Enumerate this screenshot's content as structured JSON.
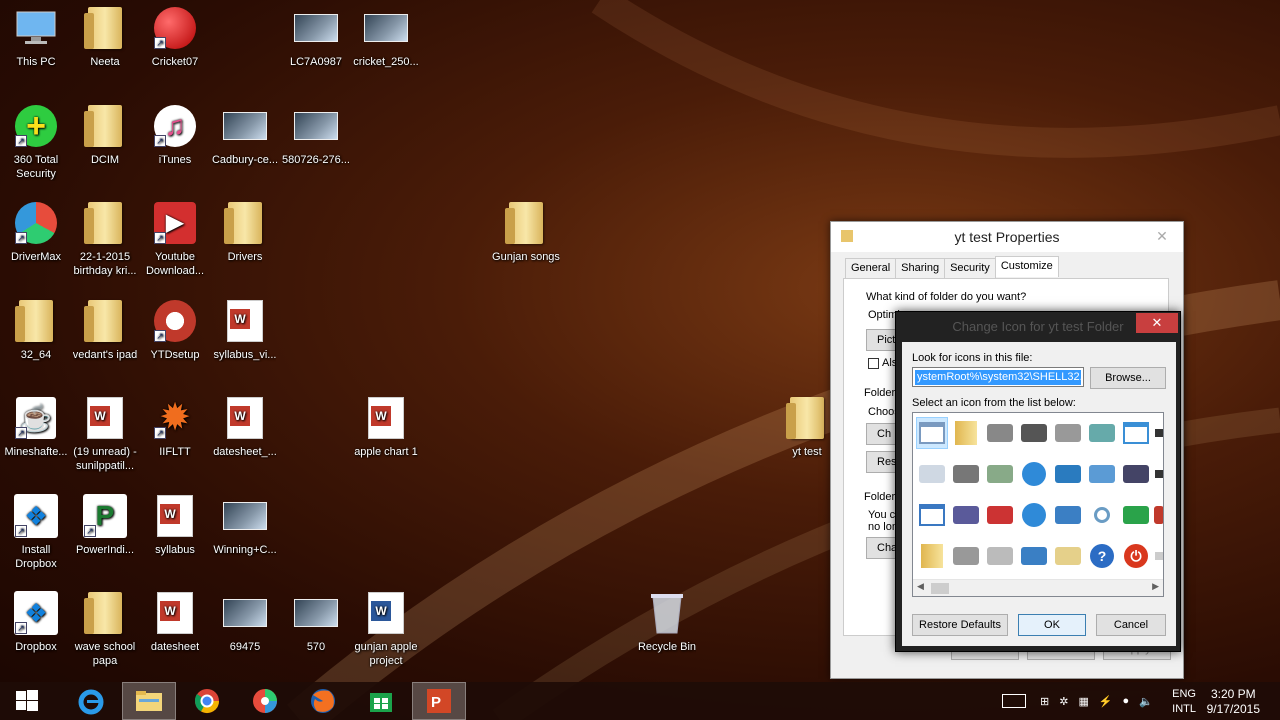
{
  "desktop": {
    "icons": [
      {
        "label": "This PC",
        "icon": "computer-icon"
      },
      {
        "label": "Neeta",
        "icon": "folder-icon"
      },
      {
        "label": "Cricket07",
        "icon": "cricket-ball-icon"
      },
      {
        "label": "LC7A0987",
        "icon": "image-icon"
      },
      {
        "label": "cricket_250...",
        "icon": "image-icon"
      },
      {
        "label": "360 Total Security",
        "icon": "security-plus-icon"
      },
      {
        "label": "DCIM",
        "icon": "folder-icon"
      },
      {
        "label": "iTunes",
        "icon": "music-note-icon"
      },
      {
        "label": "Cadbury-ce...",
        "icon": "image-icon"
      },
      {
        "label": "580726-276...",
        "icon": "image-icon"
      },
      {
        "label": "DriverMax",
        "icon": "drivermax-icon"
      },
      {
        "label": "22-1-2015 birthday kri...",
        "icon": "folder-icon"
      },
      {
        "label": "Youtube Download...",
        "icon": "video-camera-icon"
      },
      {
        "label": "Drivers",
        "icon": "folder-icon"
      },
      {
        "label": "Gunjan songs",
        "icon": "folder-icon"
      },
      {
        "label": "32_64",
        "icon": "folder-icon"
      },
      {
        "label": "vedant's ipad",
        "icon": "folder-icon"
      },
      {
        "label": "YTDsetup",
        "icon": "installer-icon"
      },
      {
        "label": "syllabus_vi...",
        "icon": "wps-document-icon"
      },
      {
        "label": "Mineshafte...",
        "icon": "java-icon"
      },
      {
        "label": "(19 unread) - sunilppatil...",
        "icon": "wps-document-icon"
      },
      {
        "label": "IIFLTT",
        "icon": "mandala-icon"
      },
      {
        "label": "datesheet_...",
        "icon": "wps-document-icon"
      },
      {
        "label": "apple chart 1",
        "icon": "wps-document-icon"
      },
      {
        "label": "yt test",
        "icon": "folder-icon"
      },
      {
        "label": "Install Dropbox",
        "icon": "dropbox-icon"
      },
      {
        "label": "PowerIndi...",
        "icon": "powerindia-icon"
      },
      {
        "label": "syllabus",
        "icon": "wps-document-icon"
      },
      {
        "label": "Winning+C...",
        "icon": "image-icon"
      },
      {
        "label": "Dropbox",
        "icon": "dropbox-icon"
      },
      {
        "label": "wave school papa",
        "icon": "folder-icon"
      },
      {
        "label": "datesheet",
        "icon": "wps-document-icon"
      },
      {
        "label": "69475",
        "icon": "image-icon"
      },
      {
        "label": "570",
        "icon": "image-icon"
      },
      {
        "label": "gunjan apple project",
        "icon": "word-document-icon"
      },
      {
        "label": "Recycle Bin",
        "icon": "recycle-bin-icon"
      }
    ]
  },
  "properties": {
    "title": "yt test Properties",
    "tabs": [
      "General",
      "Sharing",
      "Security",
      "Customize"
    ],
    "active_tab": "Customize",
    "question": "What kind of folder do you want?",
    "optimize_label": "Optimi",
    "picture_value": "Pictur",
    "also_label": "Als",
    "folder_pictures_label": "Folder",
    "choose_label": "Choos",
    "choose_btn": "Ch",
    "restore_btn": "Res",
    "folder_icons_label": "Folder",
    "you_can_label": "You ca",
    "no_longer_label": "no lon",
    "change_btn": "Cha",
    "ok": "OK",
    "cancel": "Cancel",
    "apply": "Apply"
  },
  "change_icon": {
    "title": "Change Icon for yt test Folder",
    "look_label": "Look for icons in this file:",
    "path_value": "ystemRoot%\\system32\\SHELL32.dll",
    "browse": "Browse...",
    "select_label": "Select an icon from the list below:",
    "restore_defaults": "Restore Defaults",
    "ok": "OK",
    "cancel": "Cancel"
  },
  "taskbar": {
    "apps": [
      "windows-start-icon",
      "internet-explorer-icon",
      "file-explorer-icon",
      "chrome-icon",
      "drivermax-icon",
      "firefox-icon",
      "store-icon",
      "wps-presentation-icon"
    ],
    "language": "ENG",
    "keyboard": "INTL",
    "time": "3:20 PM",
    "date": "9/17/2015"
  }
}
